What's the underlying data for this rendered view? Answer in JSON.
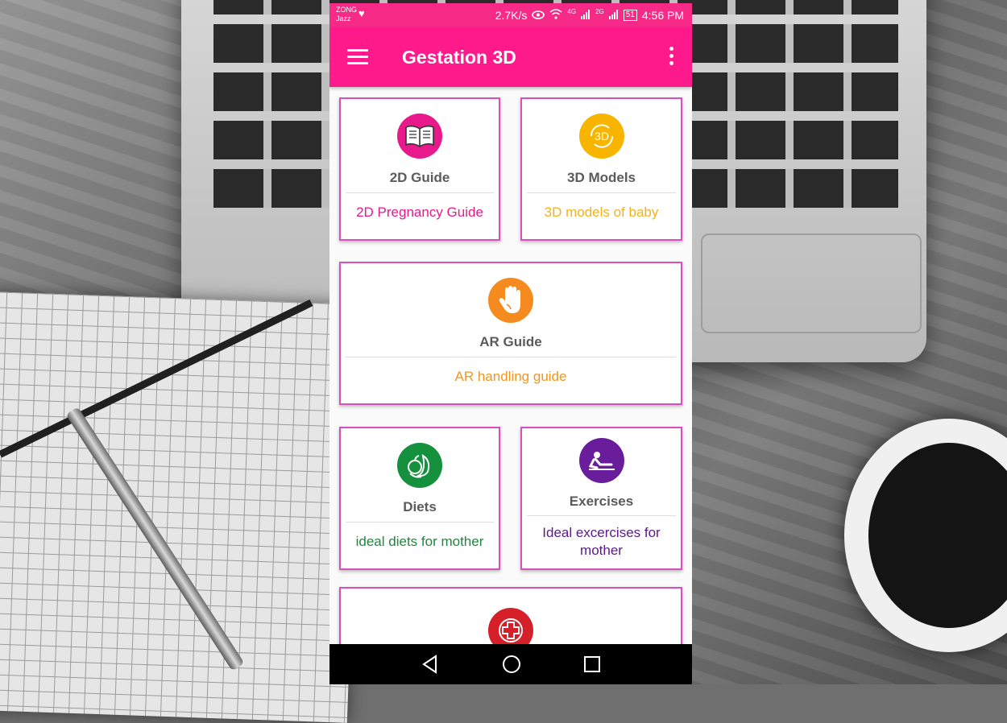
{
  "statusbar": {
    "carrier_line1": "ZONG",
    "carrier_line2": "Jazz",
    "speed": "2.7K/s",
    "signal_4g": "4G",
    "signal_2g": "2G",
    "battery": "51",
    "time": "4:56 PM"
  },
  "toolbar": {
    "title": "Gestation 3D",
    "menu_icon": "hamburger-icon",
    "more_icon": "overflow-menu-icon"
  },
  "cards": {
    "guide2d": {
      "title": "2D Guide",
      "subtitle": "2D Pregnancy Guide",
      "icon": "open-book-icon",
      "color": "#e8198b",
      "text_color": "#e8198b"
    },
    "models3d": {
      "title": "3D Models",
      "subtitle": "3D models of baby",
      "icon": "3d-rotate-icon",
      "color": "#f7b500",
      "text_color": "#f2b31a"
    },
    "ar": {
      "title": "AR Guide",
      "subtitle": "AR handling guide",
      "icon": "hand-icon",
      "color": "#f58b1f",
      "text_color": "#f0961e"
    },
    "diets": {
      "title": "Diets",
      "subtitle": "ideal diets for mother",
      "icon": "vegetables-icon",
      "color": "#15913d",
      "text_color": "#1a8a3c"
    },
    "exercises": {
      "title": "Exercises",
      "subtitle": "Ideal excercises for mother",
      "icon": "exercise-icon",
      "color": "#6a1d9a",
      "text_color": "#5a1a8a"
    },
    "medical": {
      "icon": "medical-cross-icon",
      "color": "#d5202a"
    }
  },
  "navbar": {
    "back": "back-icon",
    "home": "home-icon",
    "recents": "recents-icon"
  }
}
